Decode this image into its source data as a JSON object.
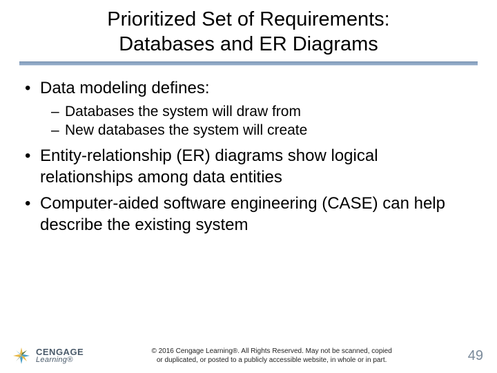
{
  "title": {
    "line1": "Prioritized Set of Requirements:",
    "line2": "Databases and ER Diagrams"
  },
  "bullets": [
    {
      "text": "Data modeling defines:",
      "children": [
        "Databases the system will draw from",
        "New databases the system will create"
      ]
    },
    {
      "text": "Entity-relationship (ER) diagrams show logical relationships among data entities"
    },
    {
      "text": "Computer-aided software engineering (CASE) can help describe the existing system"
    }
  ],
  "footer": {
    "brand": "CENGAGE",
    "brand_sub": "Learning®",
    "copyright_line1": "© 2016 Cengage Learning®. All Rights Reserved. May not be scanned, copied",
    "copyright_line2": "or duplicated, or posted to a publicly accessible website, in whole or in part.",
    "page_number": "49"
  },
  "colors": {
    "rule": "#8ea7c4",
    "page_num": "#7a8a9a"
  }
}
